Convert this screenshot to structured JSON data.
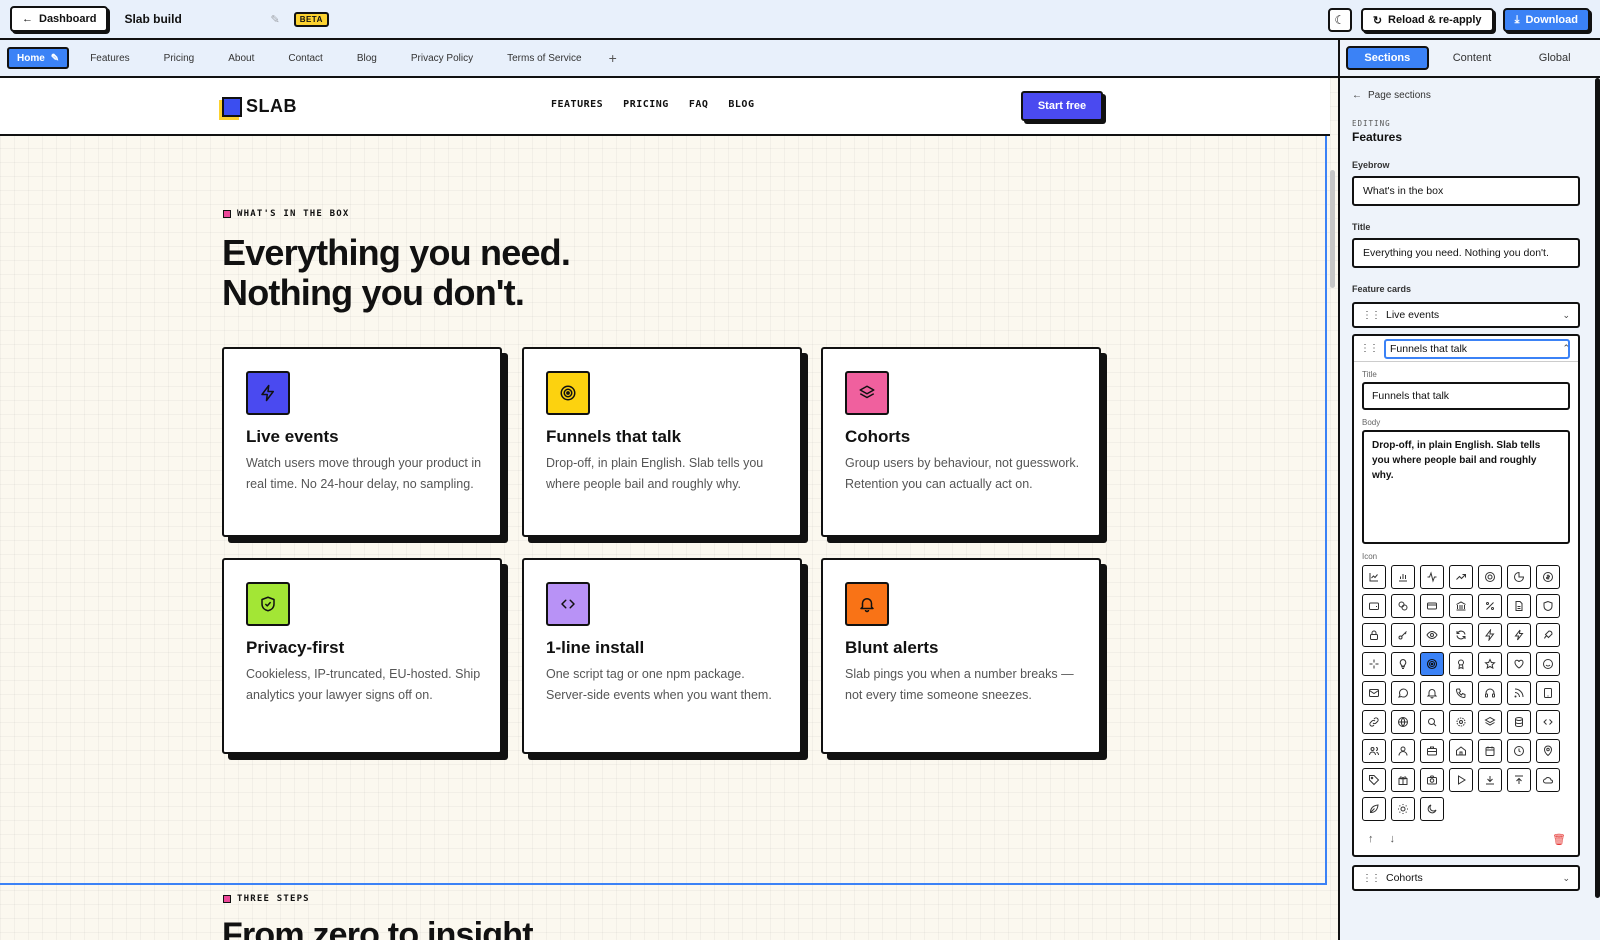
{
  "topbar": {
    "dashboard_label": "Dashboard",
    "doc_title": "Slab build",
    "beta_badge": "BETA",
    "reload_label": "Reload & re-apply",
    "download_label": "Download"
  },
  "page_tabs": [
    {
      "label": "Home",
      "active": true
    },
    {
      "label": "Features"
    },
    {
      "label": "Pricing"
    },
    {
      "label": "About"
    },
    {
      "label": "Contact"
    },
    {
      "label": "Blog"
    },
    {
      "label": "Privacy Policy"
    },
    {
      "label": "Terms of Service"
    }
  ],
  "add_page_label": "+",
  "site": {
    "logo_text": "SLAB",
    "nav": [
      "FEATURES",
      "PRICING",
      "FAQ",
      "BLOG"
    ],
    "cta": "Start free"
  },
  "features": {
    "eyebrow": "What's in the box",
    "title_line1": "Everything you need.",
    "title_line2": "Nothing you don't.",
    "cards": [
      {
        "title": "Live events",
        "body": "Watch users move through your product in real time. No 24-hour delay, no sampling.",
        "icon": "bolt-icon",
        "color": "#4a4af0"
      },
      {
        "title": "Funnels that talk",
        "body": "Drop-off, in plain English. Slab tells you where people bail and roughly why.",
        "icon": "target-icon",
        "color": "#fcd20f"
      },
      {
        "title": "Cohorts",
        "body": "Group users by behaviour, not guesswork. Retention you can actually act on.",
        "icon": "layers-icon",
        "color": "#f0609e"
      },
      {
        "title": "Privacy-first",
        "body": "Cookieless, IP-truncated, EU-hosted. Ship analytics your lawyer signs off on.",
        "icon": "shield-check-icon",
        "color": "#a3e635"
      },
      {
        "title": "1-line install",
        "body": "One script tag or one npm package. Server-side events when you want them.",
        "icon": "code-icon",
        "color": "#b892f6"
      },
      {
        "title": "Blunt alerts",
        "body": "Slab pings you when a number breaks — not every time someone sneezes.",
        "icon": "bell-icon",
        "color": "#f97316"
      }
    ]
  },
  "steps": {
    "eyebrow": "Three steps",
    "title": "From zero to insight"
  },
  "panel": {
    "tabs": [
      {
        "label": "Sections",
        "active": true
      },
      {
        "label": "Content"
      },
      {
        "label": "Global"
      }
    ],
    "back_label": "Page sections",
    "editing_label": "EDITING",
    "editing_name": "Features",
    "eyebrow_label": "Eyebrow",
    "eyebrow_value": "What's in the box",
    "title_label": "Title",
    "title_value": "Everything you need. Nothing you don't.",
    "cards_label": "Feature cards",
    "card_items": [
      "Live events",
      "Funnels that talk",
      "Cohorts"
    ],
    "open_card": {
      "name": "Funnels that talk",
      "title_label": "Title",
      "title_value": "Funnels that talk",
      "body_label": "Body",
      "body_value": "Drop-off, in plain English. Slab tells you where people bail and roughly why.",
      "icon_label": "Icon",
      "selected_icon": "target-icon"
    }
  },
  "accent_color": "#3b82f6"
}
